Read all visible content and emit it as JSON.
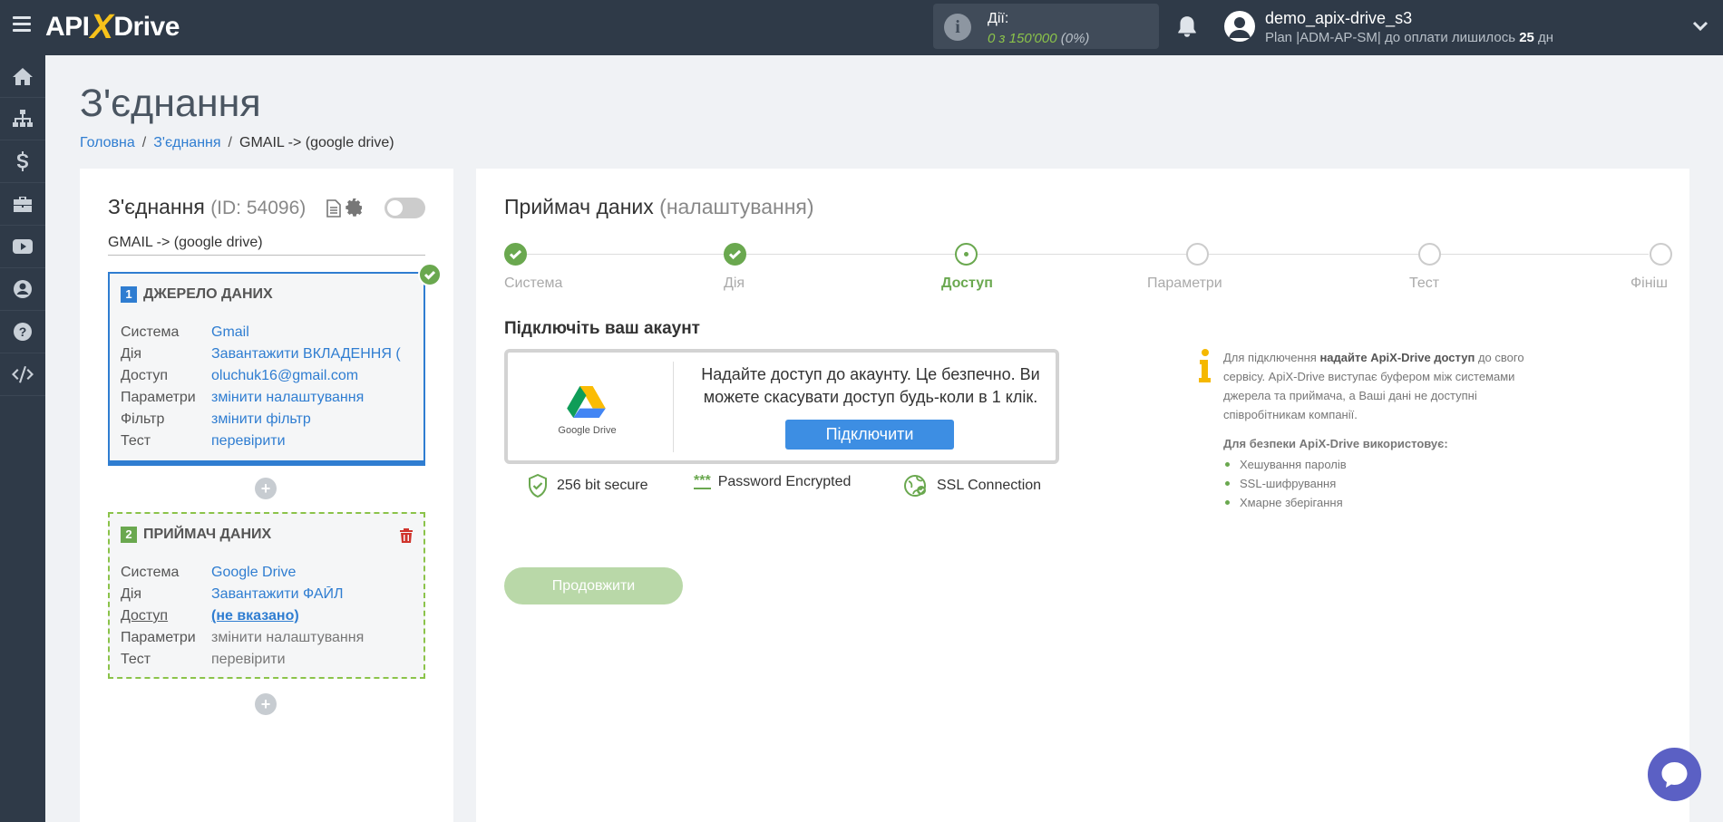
{
  "header": {
    "logo_left": "API",
    "logo_x": "X",
    "logo_right": "Drive",
    "actions_label": "Дії:",
    "actions_value": "0 з 150'000",
    "actions_pct": "(0%)",
    "user_name": "demo_apix-drive_s3",
    "plan_text": "Plan |ADM-AP-SM| до оплати лишилось ",
    "plan_days": "25",
    "plan_unit": " дн"
  },
  "sidebar": {
    "items": [
      "home-icon",
      "sitemap-icon",
      "dollar-icon",
      "briefcase-icon",
      "youtube-icon",
      "user-icon",
      "help-icon",
      "code-icon"
    ]
  },
  "page": {
    "title": "З'єднання",
    "breadcrumb": [
      "Головна",
      "З'єднання",
      "GMAIL -> (google drive)"
    ]
  },
  "connection": {
    "title": "З'єднання",
    "id_text": "(ID: 54096)",
    "name": "GMAIL -> (google drive)",
    "source": {
      "num": "1",
      "heading": "ДЖЕРЕЛО ДАНИХ",
      "rows": [
        {
          "k": "Система",
          "v": "Gmail"
        },
        {
          "k": "Дія",
          "v": "Завантажити ВКЛАДЕННЯ ("
        },
        {
          "k": "Доступ",
          "v": "oluchuk16@gmail.com"
        },
        {
          "k": "Параметри",
          "v": "змінити налаштування"
        },
        {
          "k": "Фільтр",
          "v": "змінити фільтр"
        },
        {
          "k": "Тест",
          "v": "перевірити"
        }
      ]
    },
    "dest": {
      "num": "2",
      "heading": "ПРИЙМАЧ ДАНИХ",
      "rows": [
        {
          "k": "Система",
          "v": "Google Drive"
        },
        {
          "k": "Дія",
          "v": "Завантажити ФАЙЛ"
        },
        {
          "k": "Доступ",
          "v": "(не вказано)"
        },
        {
          "k": "Параметри",
          "v": "змінити налаштування"
        },
        {
          "k": "Тест",
          "v": "перевірити"
        }
      ]
    },
    "plus": "+"
  },
  "receiver": {
    "title": "Приймач даних",
    "subtitle": "(налаштування)",
    "steps": [
      "Система",
      "Дія",
      "Доступ",
      "Параметри",
      "Тест",
      "Фініш"
    ],
    "section_title": "Підключіть ваш акаунт",
    "gd_label": "Google Drive",
    "connect_text": "Надайте доступ до акаунту. Це безпечно. Ви можете скасувати доступ будь-коли в 1 клік.",
    "connect_button": "Підключити",
    "security": [
      "256 bit secure",
      "Password Encrypted",
      "SSL Connection"
    ],
    "password_stars": "***",
    "info_p1": "Для підключення ",
    "info_p1_bold": "надайте ApiX-Drive доступ",
    "info_p2": " до свого сервісу. ApiX-Drive виступає буфером між системами джерела та приймача, а Ваші дані не доступні співробітникам компанії.",
    "info_head": "Для безпеки ApiX-Drive використовує:",
    "info_list": [
      "Хешування паролів",
      "SSL-шифрування",
      "Хмарне зберігання"
    ],
    "continue_button": "Продовжити"
  },
  "colors": {
    "topbar": "#2f3a48",
    "accent_blue": "#2f7dd1",
    "accent_green": "#6aa84f",
    "chat": "#5b60c4"
  }
}
